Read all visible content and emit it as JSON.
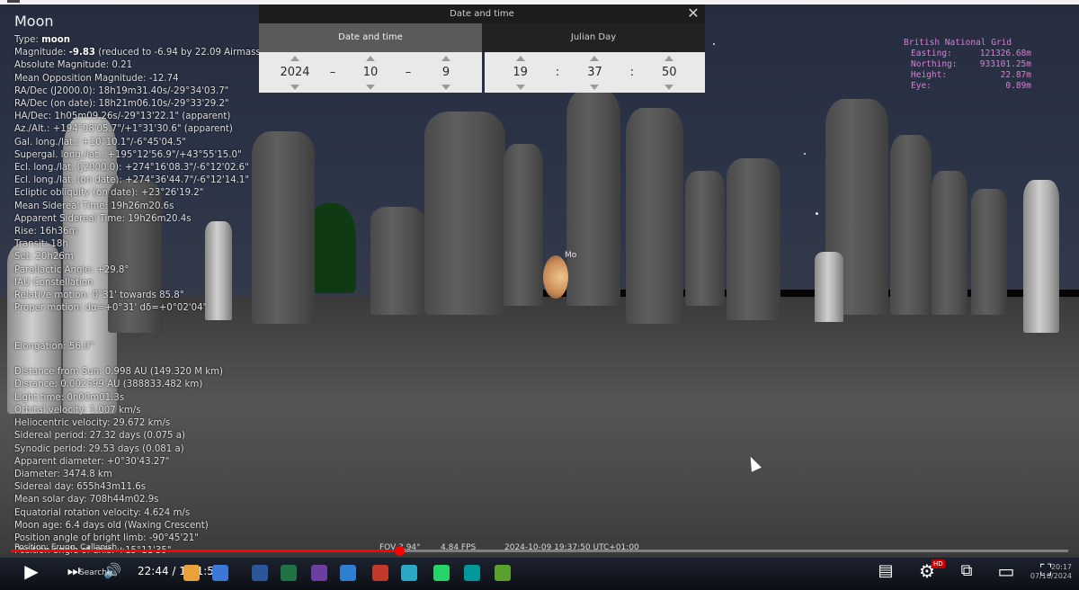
{
  "info": {
    "title": "Moon",
    "lines": [
      [
        "Type: ",
        "moon",
        ""
      ],
      [
        "Magnitude: ",
        "-9.83",
        " (reduced to -6.94 by 22.09 Airmasses)"
      ],
      [
        "Absolute Magnitude: 0.21",
        "",
        ""
      ],
      [
        "Mean Opposition Magnitude: -12.74",
        "",
        ""
      ],
      [
        "RA/Dec (J2000.0): 18h19m31.40s/-29°34'03.7\"",
        "",
        ""
      ],
      [
        "RA/Dec (on date): 18h21m06.10s/-29°33'29.2\"",
        "",
        ""
      ],
      [
        "HA/Dec: 1h05m09.26s/-29°13'22.1\" (apparent)",
        "",
        ""
      ],
      [
        "Az./Alt.: +194°08'05.7\"/+1°31'30.6\" (apparent)",
        "",
        ""
      ],
      [
        "Gal. long./lat.: +10°10.1\"/-6°45'04.5\"",
        "",
        ""
      ],
      [
        "Supergal. long./lat.: +195°12'56.9\"/+43°55'15.0\"",
        "",
        ""
      ],
      [
        "Ecl. long./lat. (J2000.0): +274°16'08.3\"/-6°12'02.6\"",
        "",
        ""
      ],
      [
        "Ecl. long./lat. (on date): +274°36'44.7\"/-6°12'14.1\"",
        "",
        ""
      ],
      [
        "Ecliptic obliquity (on date): +23°26'19.2\"",
        "",
        ""
      ],
      [
        "Mean Sidereal Time: 19h26m20.6s",
        "",
        ""
      ],
      [
        "Apparent Sidereal Time: 19h26m20.4s",
        "",
        ""
      ],
      [
        "Rise: 16h36m",
        "",
        ""
      ],
      [
        "Transit: 18h",
        "",
        ""
      ],
      [
        "Set: 20h26m",
        "",
        ""
      ],
      [
        "Parallactic Angle: +29.8°",
        "",
        ""
      ],
      [
        "IAU Constellation",
        "",
        ""
      ],
      [
        "Relative motion: 0°31' towards 85.8°",
        "",
        ""
      ],
      [
        "Proper motion: dα=+0°31' dδ=+0°02'04\"",
        "",
        ""
      ],
      [
        "",
        "",
        ""
      ],
      [
        "",
        "",
        ""
      ],
      [
        "Elongation: 56.0°",
        "",
        ""
      ],
      [
        "",
        "",
        ""
      ],
      [
        "Distance from Sun: 0.998 AU (149.320 M km)",
        "",
        ""
      ],
      [
        "Distance: 0.002599 AU (388833.482 km)",
        "",
        ""
      ],
      [
        "Light time: 0h00m01.3s",
        "",
        ""
      ],
      [
        "Orbital velocity: 1.007 km/s",
        "",
        ""
      ],
      [
        "Heliocentric velocity: 29.672 km/s",
        "",
        ""
      ],
      [
        "Sidereal period: 27.32 days (0.075 a)",
        "",
        ""
      ],
      [
        "Synodic period: 29.53 days (0.081 a)",
        "",
        ""
      ],
      [
        "Apparent diameter: +0°30'43.27\"",
        "",
        ""
      ],
      [
        "Diameter: 3474.8 km",
        "",
        ""
      ],
      [
        "Sidereal day: 655h43m11.6s",
        "",
        ""
      ],
      [
        "Mean solar day: 708h44m02.9s",
        "",
        ""
      ],
      [
        "Equatorial rotation velocity: 4.624 m/s",
        "",
        ""
      ],
      [
        "Moon age: 6.4 days old (Waxing Crescent)",
        "",
        ""
      ],
      [
        "Position angle of bright limb: -90°45'21\"",
        "",
        ""
      ],
      [
        "Position angle of axis: +15°11'35\"",
        "",
        ""
      ]
    ]
  },
  "grid": {
    "title": "British National Grid",
    "rows": [
      {
        "label": "Easting:",
        "value": "121326.68m"
      },
      {
        "label": "Northing:",
        "value": "933101.25m"
      },
      {
        "label": "Height:",
        "value": "22.87m"
      },
      {
        "label": "Eye:",
        "value": "0.89m"
      }
    ]
  },
  "dialog": {
    "title": "Date and time",
    "close": "✕",
    "tabs": {
      "date": "Date and time",
      "julian": "Julian Day"
    },
    "date": {
      "year": "2024",
      "month": "10",
      "day": "9",
      "sep": "–"
    },
    "time": {
      "hour": "19",
      "minute": "37",
      "second": "50",
      "sep": ":"
    }
  },
  "moon_label": "Mo",
  "status": {
    "fov": "FOV 3.94°",
    "fps": "4.84 FPS",
    "datetime": "2024-10-09 19:37:50 UTC+01:00",
    "position": "Position: Erugg, Callanish..."
  },
  "player": {
    "play_icon": "▶",
    "next_icon": "⏭",
    "volume_icon": "🔊",
    "current_time": "22:44",
    "duration": "1:01:55",
    "time_separator": " / ",
    "progress_percent": 36.7,
    "hd": "HD",
    "cc_icon": "▤",
    "settings_icon": "⚙",
    "miniplayer_icon": "⧉",
    "theater_icon": "▭",
    "fullscreen_icon": "⛶"
  },
  "taskbar": {
    "search": "Search",
    "clock_time": "20:17",
    "clock_date": "07/10/2024",
    "icon_colors": [
      "#3b78d8",
      "#e9a23b",
      "#2b579a",
      "#217346",
      "#6b3fa0",
      "#2f7fd1",
      "#c0392b",
      "#2aa8c4",
      "#25d366",
      "#00979d",
      "#5aa02c"
    ]
  },
  "colors": {
    "accent": "#ff0000",
    "grid_text": "#e07ad8"
  }
}
